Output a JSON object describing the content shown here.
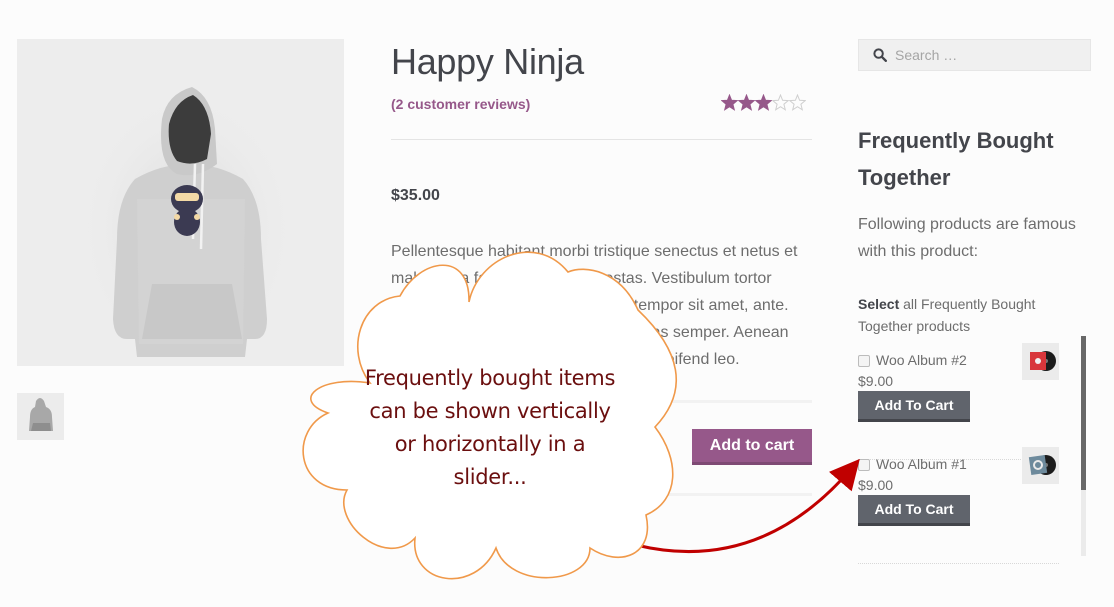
{
  "product": {
    "title": "Happy Ninja",
    "reviews_link": "(2 customer reviews)",
    "rating": 3,
    "rating_max": 5,
    "price": "$35.00",
    "description": "Pellentesque habitant morbi tristique senectus et netus et malesuada fames ac turpis egestas. Vestibulum tortor quam, feugiat vitae, ultricies eget, tempor sit amet, ante. Donec eu libero sit amet quam egestas semper. Aenean ultricies mi vitae est. Mauris placerat eleifend leo.",
    "add_to_cart_label": "Add to cart",
    "main_image_alt": "hoodie-with-ninja-logo",
    "thumbnail_alt": "hoodie-back-thumbnail"
  },
  "sidebar": {
    "search_placeholder": "Search …",
    "widget_title": "Frequently Bought Together",
    "widget_description": "Following products are famous with this product:",
    "select_all_bold": "Select",
    "select_all_rest": " all Frequently Bought Together products",
    "items": [
      {
        "name": "Woo Album #2",
        "price": "$9.00",
        "button_label": "Add To Cart",
        "checked": false,
        "thumb_color": "#d8363b"
      },
      {
        "name": "Woo Album #1",
        "price": "$9.00",
        "button_label": "Add To Cart",
        "checked": false,
        "thumb_color": "#6d8a9c"
      }
    ],
    "scroll_position": 0,
    "scroll_visible_fraction": 0.7
  },
  "callout": {
    "text_lines": [
      "Frequently bought items",
      "can be shown vertically",
      "or horizontally in a",
      "slider..."
    ],
    "stroke_color": "#f0994a",
    "text_color": "#6b0f0f",
    "arrow_color": "#c00000"
  },
  "colors": {
    "brand_purple": "#96588a",
    "dark_button": "#60646c",
    "text": "#43454b",
    "muted_text": "#6d6d6d"
  }
}
